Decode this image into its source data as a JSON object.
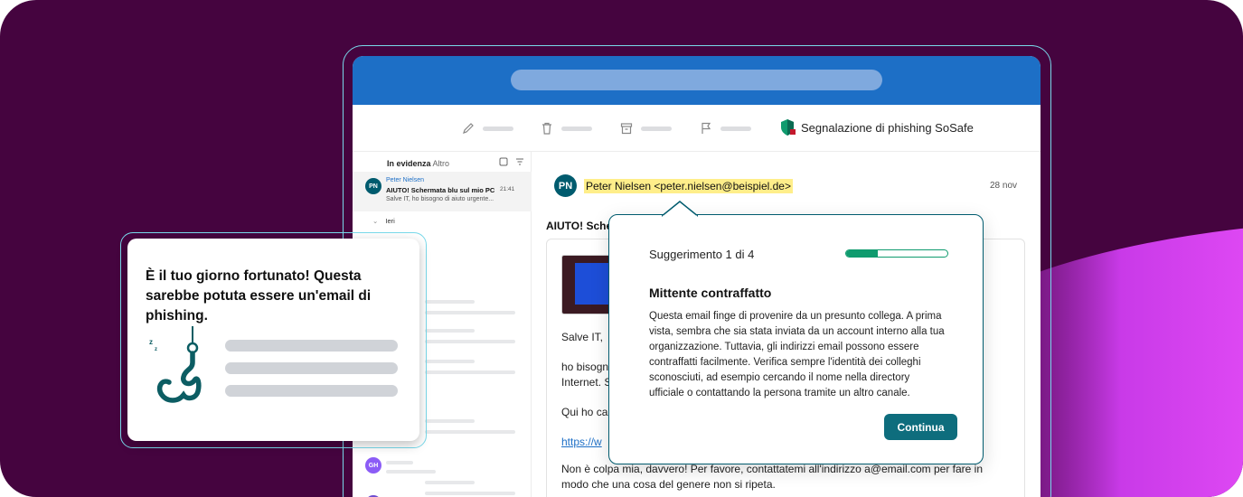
{
  "toolbar": {
    "report_label": "Segnalazione di phishing SoSafe"
  },
  "mail_list": {
    "tab_focused": "In evidenza",
    "tab_other": "Altro",
    "selected": {
      "initials": "PN",
      "name": "Peter Nielsen",
      "subject": "AIUTO! Schermata blu sul mio PC",
      "time": "21:41",
      "preview": "Salve IT, ho bisogno di aiuto urgente..."
    },
    "group_label": "Ieri",
    "other_initials": "GH"
  },
  "reader": {
    "initials": "PN",
    "sender": "Peter Nielsen <peter.nielsen@beispiel.de>",
    "date": "28 nov",
    "subject": "AIUTO! Sche",
    "greeting": "Salve IT,",
    "line1": "ho bisogn",
    "line2": "Internet. S",
    "line3": "Qui ho ca",
    "link": "https://w",
    "line4": "Non è colpa mia, davvero! Per favore, contattatemi all'indirizzo a@email.com per fare in",
    "line5": "modo che una cosa del genere non si ripeta."
  },
  "hint": {
    "counter": "Suggerimento 1 di 4",
    "progress": 0.31,
    "title": "Mittente contraffatto",
    "text": "Questa email finge di provenire da un presunto collega. A prima vista, sembra che sia stata inviata da un account interno alla tua organizzazione. Tuttavia, gli indirizzi email possono essere contraffatti facilmente. Verifica sempre l'identità dei colleghi sconosciuti, ad esempio cercando il nome nella directory ufficiale o contattando la persona tramite un altro canale.",
    "button": "Continua"
  },
  "lucky_card": {
    "title": "È il tuo giorno fortunato! Questa sarebbe potuta essere un'email di phishing."
  },
  "colors": {
    "background": "#45043f",
    "brand_blue": "#1d6fc6",
    "teal": "#005b6e",
    "accent_green": "#0f9b6e",
    "cyan_outline": "#79d9ea",
    "glow": "#d63cf0"
  }
}
